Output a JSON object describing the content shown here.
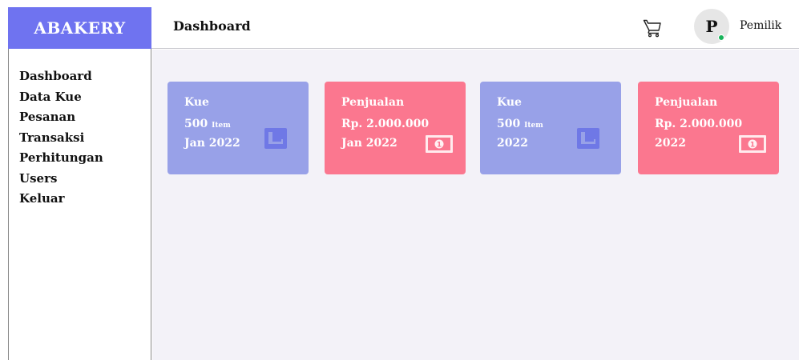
{
  "app": {
    "brand": "ABAKERY"
  },
  "header": {
    "title": "Dashboard",
    "cart_icon": "shopping-cart-icon",
    "user": {
      "avatar_letter": "P",
      "name": "Pemilik",
      "status_color": "#19b35a"
    }
  },
  "sidebar": {
    "items": [
      {
        "label": "Dashboard"
      },
      {
        "label": "Data Kue"
      },
      {
        "label": "Pesanan"
      },
      {
        "label": "Transaksi"
      },
      {
        "label": "Perhitungan"
      },
      {
        "label": "Users"
      },
      {
        "label": "Keluar"
      }
    ]
  },
  "cards": [
    {
      "title": "Kue",
      "value": "500",
      "unit": "Item",
      "period": "Jan 2022",
      "color": "#98a1e8",
      "icon": "cart-icon"
    },
    {
      "title": "Penjualan",
      "value": "Rp. 2.000.000",
      "unit": "",
      "period": "Jan 2022",
      "color": "#fb778f",
      "icon": "money-icon"
    },
    {
      "title": "Kue",
      "value": "500",
      "unit": "Item",
      "period": "2022",
      "color": "#98a1e8",
      "icon": "cart-icon"
    },
    {
      "title": "Penjualan",
      "value": "Rp. 2.000.000",
      "unit": "",
      "period": "2022",
      "color": "#fb778f",
      "icon": "money-icon"
    }
  ],
  "colors": {
    "brand": "#6f73f0",
    "main_bg": "#f3f2f8"
  }
}
